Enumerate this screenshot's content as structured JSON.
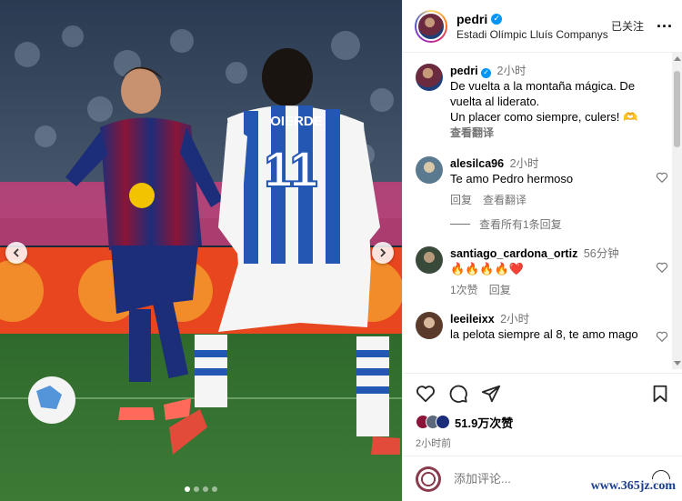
{
  "post": {
    "username": "pedri",
    "location": "Estadi Olímpic Lluís Companys",
    "follow_label": "已关注",
    "more_label": "...",
    "carousel_dots": 4
  },
  "media": {
    "player_number": "11",
    "player_name": "OIERDE"
  },
  "caption": {
    "username": "pedri",
    "time": "2小时",
    "text_lines": [
      "De vuelta a la montaña mágica. De vuelta al liderato.",
      "Un placer como siempre, culers! 🫶"
    ],
    "translate_label": "查看翻译"
  },
  "comments": [
    {
      "username": "alesilca96",
      "time": "2小时",
      "text": "Te amo Pedro hermoso",
      "actions": [
        "回复",
        "查看翻译"
      ],
      "view_replies": "查看所有1条回复"
    },
    {
      "username": "santiago_cardona_ortiz",
      "time": "56分钟",
      "text": "🔥🔥🔥🔥❤️",
      "actions": [
        "1次赞",
        "回复"
      ]
    },
    {
      "username": "leeileixx",
      "time": "2小时",
      "text": "la pelota siempre al 8, te amo mago",
      "actions": []
    }
  ],
  "stats": {
    "likes": "51.9万次赞",
    "posted": "2小时前"
  },
  "composer": {
    "placeholder": "添加评论..."
  },
  "watermark": "www.365jz.com"
}
